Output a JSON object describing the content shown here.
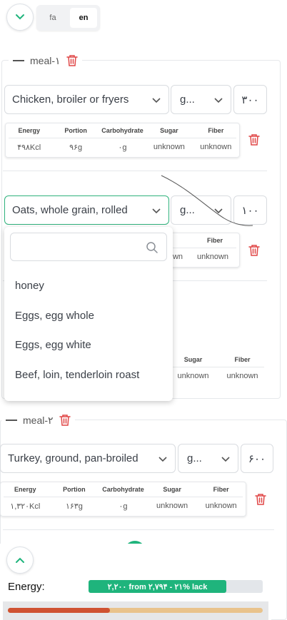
{
  "header": {
    "collapse_icon": "chevron-down-icon",
    "languages": [
      {
        "code": "fa",
        "active": false
      },
      {
        "code": "en",
        "active": true
      }
    ]
  },
  "meals": [
    {
      "title": "meal-۱",
      "items": [
        {
          "food": "Chicken, broiler or fryers",
          "unit": "g...",
          "quantity": "۳۰۰",
          "nutrients": {
            "headers": [
              "Energy",
              "Portion",
              "Carbohydrate",
              "Sugar",
              "Fiber"
            ],
            "values": [
              "۴۹۸Kcl",
              "۹۶g",
              "۰g",
              "unknown",
              "unknown"
            ]
          }
        },
        {
          "food": "Oats, whole grain, rolled",
          "unit": "g...",
          "quantity": "۱۰۰",
          "nutrients": {
            "headers": [
              "Fiber"
            ],
            "values": [
              "wn",
              "unknown"
            ]
          }
        },
        {
          "nutrients": {
            "headers": [
              "Sugar",
              "Fiber"
            ],
            "values": [
              "unknown",
              "unknown"
            ]
          }
        }
      ]
    },
    {
      "title": "meal-۲",
      "items": [
        {
          "food": "Turkey, ground, pan-broiled",
          "unit": "g...",
          "quantity": "۶۰۰",
          "nutrients": {
            "headers": [
              "Energy",
              "Portion",
              "Carbohydrate",
              "Sugar",
              "Fiber"
            ],
            "values": [
              "۱,۳۲۰Kcl",
              "۱۶۳g",
              "۰g",
              "unknown",
              "unknown"
            ]
          }
        }
      ]
    }
  ],
  "dropdown": {
    "search_value": "",
    "search_icon": "search-icon",
    "options": [
      "honey",
      "Eggs, egg whole",
      "Eggs, egg white",
      "Beef, loin, tenderloin roast"
    ]
  },
  "summary": {
    "expand_icon": "chevron-up-icon",
    "energy_label": "Energy:",
    "energy_text": "۲,۲۰۰ from ۲,۷۹۴ - ۲۱% lack",
    "energy_fraction": 0.79,
    "progress_fraction": 0.4,
    "colors": {
      "accent": "#1fb47c",
      "danger": "#e04646",
      "progress_fill": "#cf5232",
      "progress_track": "#e9c38c"
    }
  }
}
